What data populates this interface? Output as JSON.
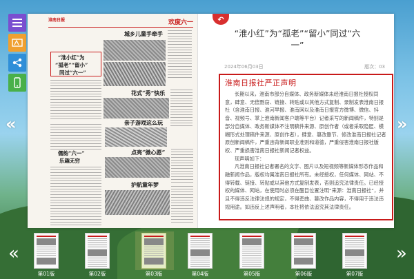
{
  "side_menu": [
    {
      "icon": "menu-icon"
    },
    {
      "icon": "font-size-icon"
    },
    {
      "icon": "share-icon"
    },
    {
      "icon": "mobile-icon"
    }
  ],
  "newspaper": {
    "masthead_left": "淮南日报",
    "masthead_right": "欢度六一",
    "headlines": [
      "城乡儿童手牵手",
      "“淮小红”为",
      "“孤老”“留小”",
      "同过“六一”",
      "花式“秀”快乐",
      "亲子游戏这么玩",
      "点亮“微心愿”",
      "护航童年梦",
      "儒韵“六一”",
      "乐趣无穷"
    ]
  },
  "article": {
    "back_icon": "back-arrow-icon",
    "title_line1": "“淮小红”为“孤老”“留小”同过“六",
    "title_line2": "一”",
    "date": "2024年06月03日",
    "edition": "版次：03",
    "heading": "淮南日报社严正声明",
    "paragraphs": [
      "长期以来，淮南市部分自媒体、政务新媒体未经淮南日报社授权同意，肆意、无偿剽窃、链接、转贴或以其他方式复制、录制发表淮南日报社（含淮南日报、淮河早报、淮南网以及淮南日报官方微博、微信、抖音、视频号、掌上淮南新闻客户端等平台）记者采写的新闻稿件，特别是部分自媒体、政务新媒体不注明稿件来源、原创作者（或者采取隐匿、模糊形式处理稿件来源、原创作者），肆意、篡改删节、修改淮南日报社记者原创新闻稿件，严重违背新闻职业准则和道德，严重侵害淮南日报社版权、严重损害淮南日报社新闻记者权益。",
      "现声明如下：",
      "凡淮南日报社记者署名的文字、图片以及短视频等新媒体形态作品和融新闻作品，版权均属淮南日报社所有。未经授权，任何媒体、网站、不得转载、链接、转贴或以其他方式复制发表，否则追究法律责任。已经授权的媒体、网站，在使用时必须在醒目位置注明“来源：淮南日报社”，并且不得违反法律法规的规定，不得歪曲、篡改作品内容，不得用于违法违规用途。如违反上述声明者，本社将依法追究其法律责任。"
    ]
  },
  "thumbnails": [
    {
      "label": "第01版"
    },
    {
      "label": "第02版"
    },
    {
      "label": "第03版"
    },
    {
      "label": "第04版"
    },
    {
      "label": "第05版"
    },
    {
      "label": "第06版"
    },
    {
      "label": "第07版"
    }
  ],
  "nav": {
    "prev_icon": "double-chevron-left-icon",
    "next_icon": "double-chevron-right-icon"
  }
}
